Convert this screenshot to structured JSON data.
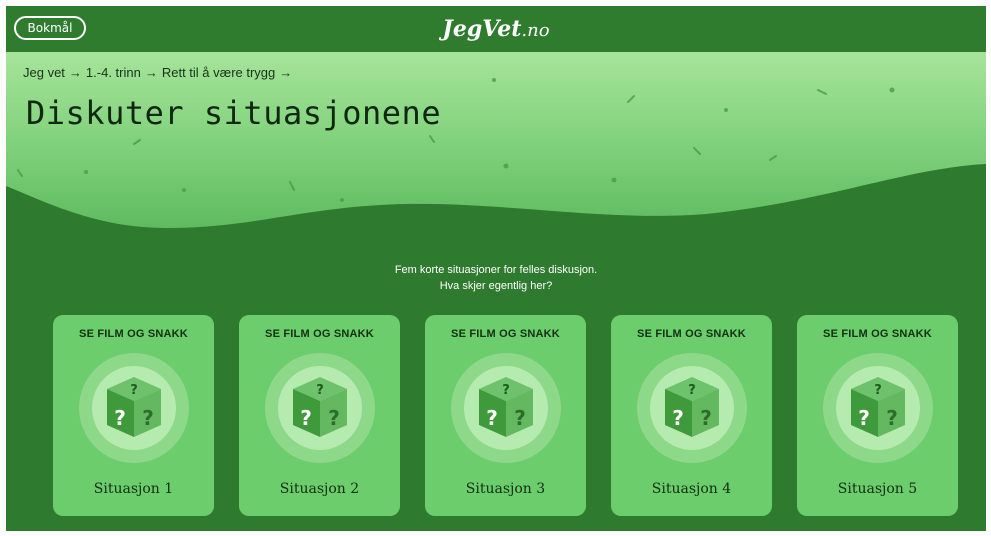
{
  "header": {
    "language_button": "Bokmål",
    "logo_main": "JegVet",
    "logo_ext": ".no"
  },
  "breadcrumb": {
    "items": [
      "Jeg vet",
      "1.-4. trinn",
      "Rett til å være trygg"
    ],
    "separator": "→"
  },
  "page_title": "Diskuter situasjonene",
  "intro": {
    "line1": "Fem korte situasjoner for felles diskusjon.",
    "line2": "Hva skjer egentlig her?"
  },
  "cards": [
    {
      "label": "SE FILM OG SNAKK",
      "name": "Situasjon 1"
    },
    {
      "label": "SE FILM OG SNAKK",
      "name": "Situasjon 2"
    },
    {
      "label": "SE FILM OG SNAKK",
      "name": "Situasjon 3"
    },
    {
      "label": "SE FILM OG SNAKK",
      "name": "Situasjon 4"
    },
    {
      "label": "SE FILM OG SNAKK",
      "name": "Situasjon 5"
    }
  ],
  "icons": {
    "card_icon": "mystery-box-icon",
    "separator_icon": "arrow-right-icon"
  },
  "colors": {
    "header_bg": "#2f7c2f",
    "hero_light": "#a6e49a",
    "hero_dark": "#5fbb5f",
    "page_bg": "#2e7a2e",
    "card_bg": "#6bcd6b"
  }
}
